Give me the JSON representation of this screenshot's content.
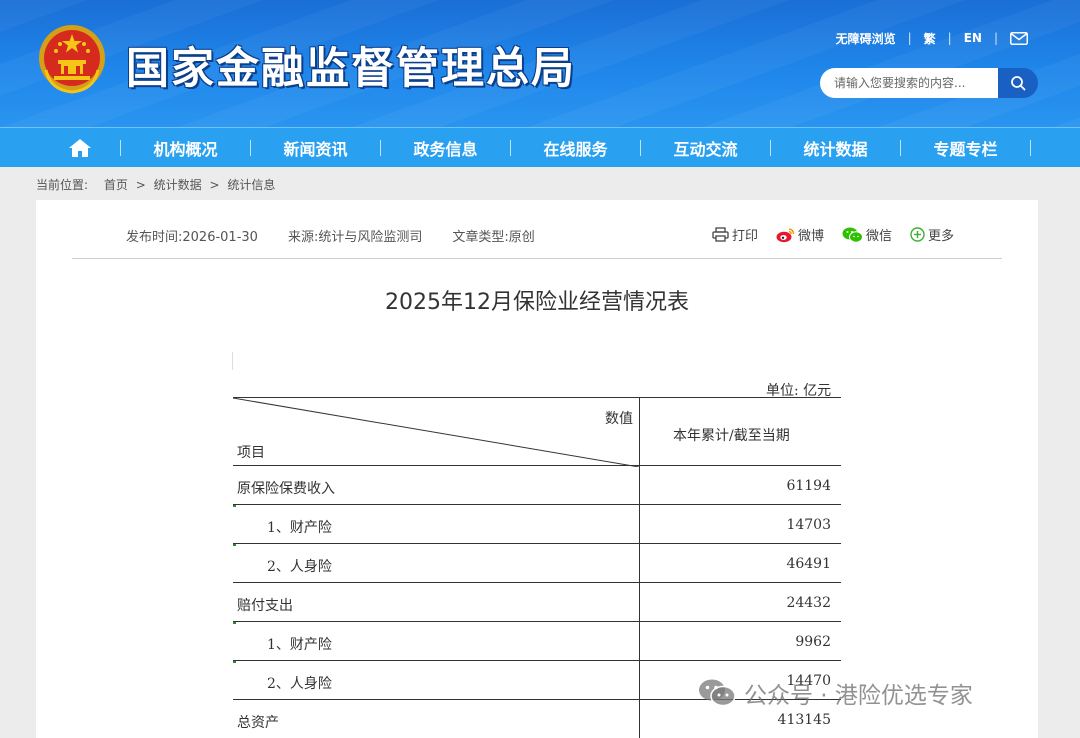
{
  "header": {
    "site_title": "国家金融监督管理总局",
    "top_links": [
      "无障碍浏览",
      "繁",
      "EN"
    ],
    "search_placeholder": "请输入您要搜索的内容..."
  },
  "nav": {
    "items": [
      "机构概况",
      "新闻资讯",
      "政务信息",
      "在线服务",
      "互动交流",
      "统计数据",
      "专题专栏"
    ]
  },
  "breadcrumb": {
    "label": "当前位置:",
    "items": [
      "首页",
      ">",
      "统计数据",
      ">",
      "统计信息"
    ]
  },
  "article": {
    "publish_time": "发布时间:2026-01-30",
    "source": "来源:统计与风险监测司",
    "type": "文章类型:原创",
    "share": {
      "print": "打印",
      "weibo": "微博",
      "wechat": "微信",
      "more": "更多"
    },
    "title": "2025年12月保险业经营情况表"
  },
  "table": {
    "unit": "单位: 亿元",
    "header_value": "数值",
    "header_item": "项目",
    "header_col": "本年累计/截至当期",
    "rows": [
      {
        "name": "原保险保费收入",
        "value": "61194"
      },
      {
        "name": "1、财产险",
        "value": "14703"
      },
      {
        "name": "2、人身险",
        "value": "46491"
      },
      {
        "name": "赔付支出",
        "value": "24432"
      },
      {
        "name": "1、财产险",
        "value": "9962"
      },
      {
        "name": "2、人身险",
        "value": "14470"
      },
      {
        "name": "总资产",
        "value": "413145"
      }
    ]
  },
  "watermark": {
    "text": "公众号 · 港险优选专家"
  },
  "colors": {
    "header_blue": "#1f86ea",
    "nav_blue": "#2aa0f0",
    "search_btn": "#1a5fc2"
  }
}
